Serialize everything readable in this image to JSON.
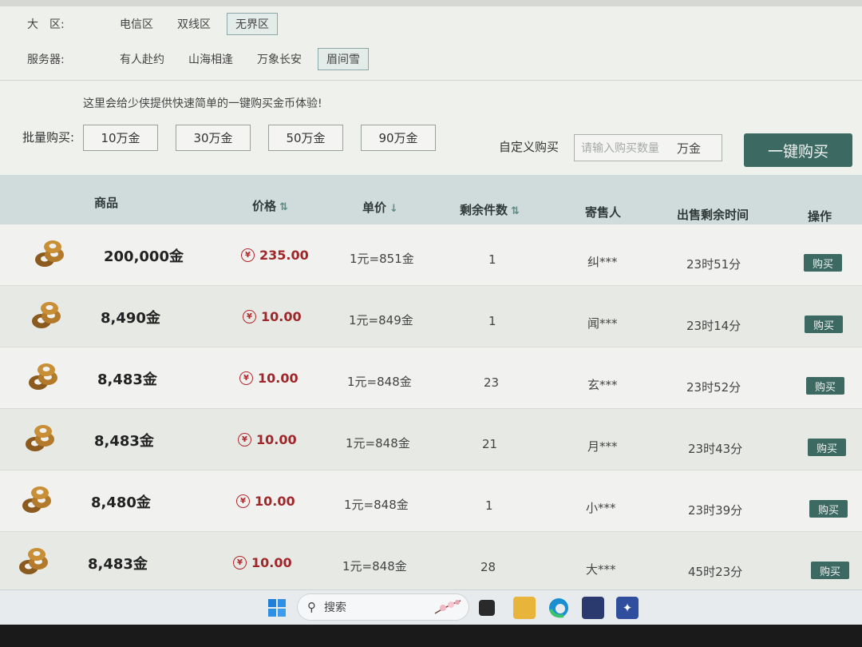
{
  "filters": {
    "region_label": "大　区:",
    "regions": [
      {
        "label": "电信区",
        "active": false
      },
      {
        "label": "双线区",
        "active": false
      },
      {
        "label": "无界区",
        "active": true
      }
    ],
    "server_label": "服务器:",
    "servers": [
      {
        "label": "有人赴约",
        "active": false
      },
      {
        "label": "山海相逢",
        "active": false
      },
      {
        "label": "万象长安",
        "active": false
      },
      {
        "label": "眉间雪",
        "active": true
      }
    ]
  },
  "buy": {
    "tip": "这里会给少侠提供快速简单的一键购买金币体验!",
    "bulk_label": "批量购买:",
    "amounts": [
      "10万金",
      "30万金",
      "50万金",
      "90万金"
    ],
    "custom_label": "自定义购买",
    "custom_placeholder": "请输入购买数量",
    "custom_unit": "万金",
    "one_click": "一键购买"
  },
  "table": {
    "headers": {
      "item": "商品",
      "price": "价格",
      "unit_price": "单价",
      "remaining": "剩余件数",
      "seller": "寄售人",
      "time_left": "出售剩余时间",
      "action": "操作"
    },
    "rows": [
      {
        "amount": "200,000金",
        "price": "235.00",
        "unit": "1元=851金",
        "remaining": "1",
        "seller": "纠***",
        "time": "23时51分",
        "buy": "购买"
      },
      {
        "amount": "8,490金",
        "price": "10.00",
        "unit": "1元=849金",
        "remaining": "1",
        "seller": "闻***",
        "time": "23时14分",
        "buy": "购买"
      },
      {
        "amount": "8,483金",
        "price": "10.00",
        "unit": "1元=848金",
        "remaining": "23",
        "seller": "玄***",
        "time": "23时52分",
        "buy": "购买"
      },
      {
        "amount": "8,483金",
        "price": "10.00",
        "unit": "1元=848金",
        "remaining": "21",
        "seller": "月***",
        "time": "23时43分",
        "buy": "购买"
      },
      {
        "amount": "8,480金",
        "price": "10.00",
        "unit": "1元=848金",
        "remaining": "1",
        "seller": "小***",
        "time": "23时39分",
        "buy": "购买"
      },
      {
        "amount": "8,483金",
        "price": "10.00",
        "unit": "1元=848金",
        "remaining": "28",
        "seller": "大***",
        "time": "45时23分",
        "buy": "购买"
      }
    ]
  },
  "taskbar": {
    "search_label": "搜索"
  },
  "colors": {
    "accent": "#3c6962",
    "price": "#a0262a",
    "header_bg": "#cfdcdb"
  }
}
